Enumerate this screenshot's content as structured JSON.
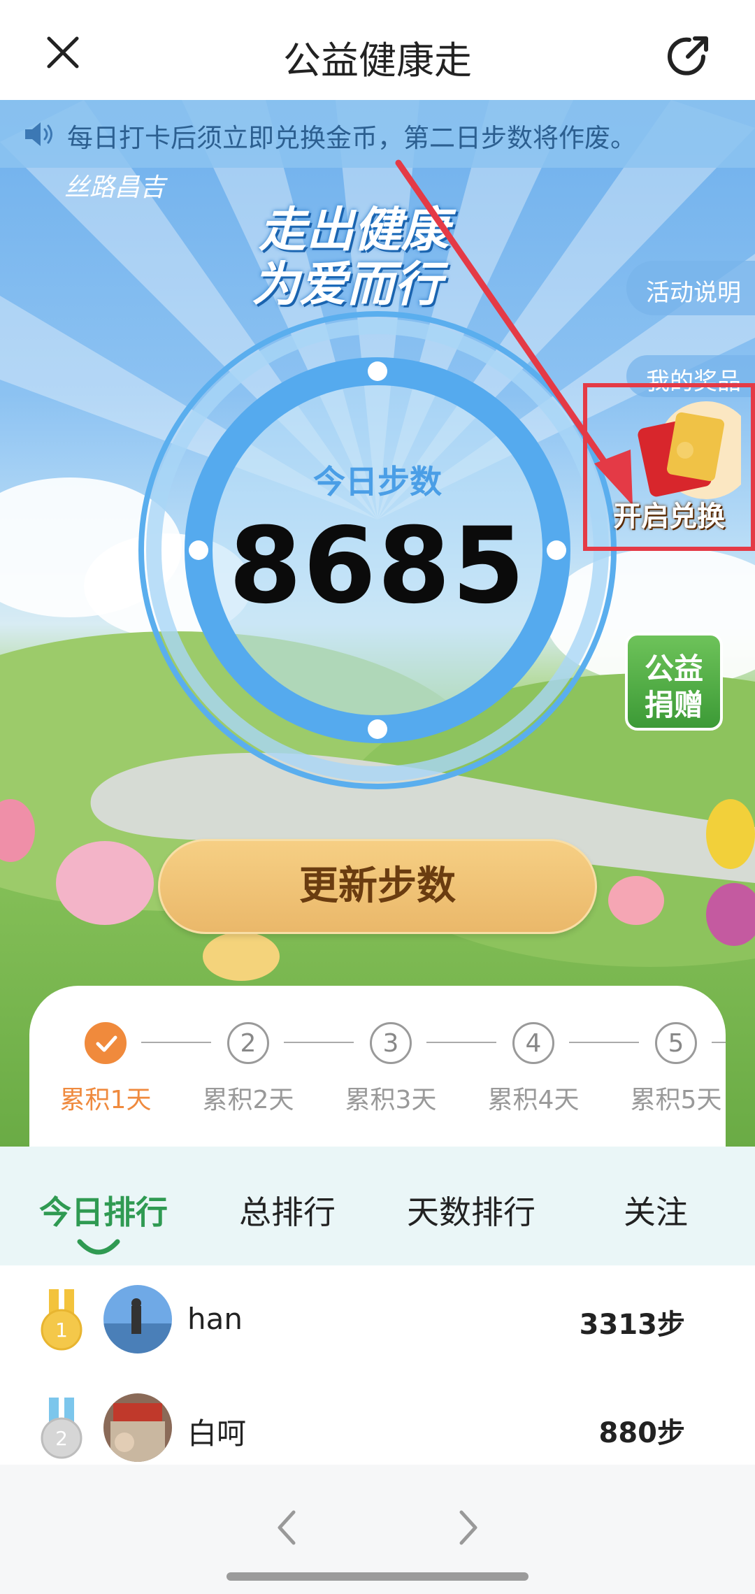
{
  "header": {
    "title": "公益健康走",
    "close_icon": "close-icon",
    "share_icon": "share-icon"
  },
  "notice": {
    "text": "每日打卡后须立即兑换金币，第二日步数将作废。",
    "icon": "speaker-icon"
  },
  "hero": {
    "brand": "丝路昌吉",
    "slogan_line1": "走出健康",
    "slogan_line2": "为爱而行",
    "side_buttons": {
      "activity_info": "活动说明",
      "my_prizes": "我的奖品"
    },
    "redeem_label": "开启兑换",
    "donate_line1": "公益",
    "donate_line2": "捐赠",
    "steps_label": "今日步数",
    "steps_value": "8685",
    "update_button": "更新步数"
  },
  "streak": {
    "days": [
      {
        "num": "1",
        "label": "累积1天",
        "done": true
      },
      {
        "num": "2",
        "label": "累积2天",
        "done": false
      },
      {
        "num": "3",
        "label": "累积3天",
        "done": false
      },
      {
        "num": "4",
        "label": "累积4天",
        "done": false
      },
      {
        "num": "5",
        "label": "累积5天",
        "done": false
      }
    ]
  },
  "tabs": [
    {
      "label": "今日排行",
      "active": true
    },
    {
      "label": "总排行",
      "active": false
    },
    {
      "label": "天数排行",
      "active": false
    },
    {
      "label": "关注",
      "active": false
    }
  ],
  "ranking": [
    {
      "rank": "1",
      "name": "han",
      "steps": "3313步"
    },
    {
      "rank": "2",
      "name": "白呵",
      "steps": "880步"
    }
  ],
  "colors": {
    "accent_green": "#2f9a52",
    "accent_orange": "#f08a3c",
    "ring_blue": "#5aaeee",
    "highlight_red": "#e43a46"
  }
}
